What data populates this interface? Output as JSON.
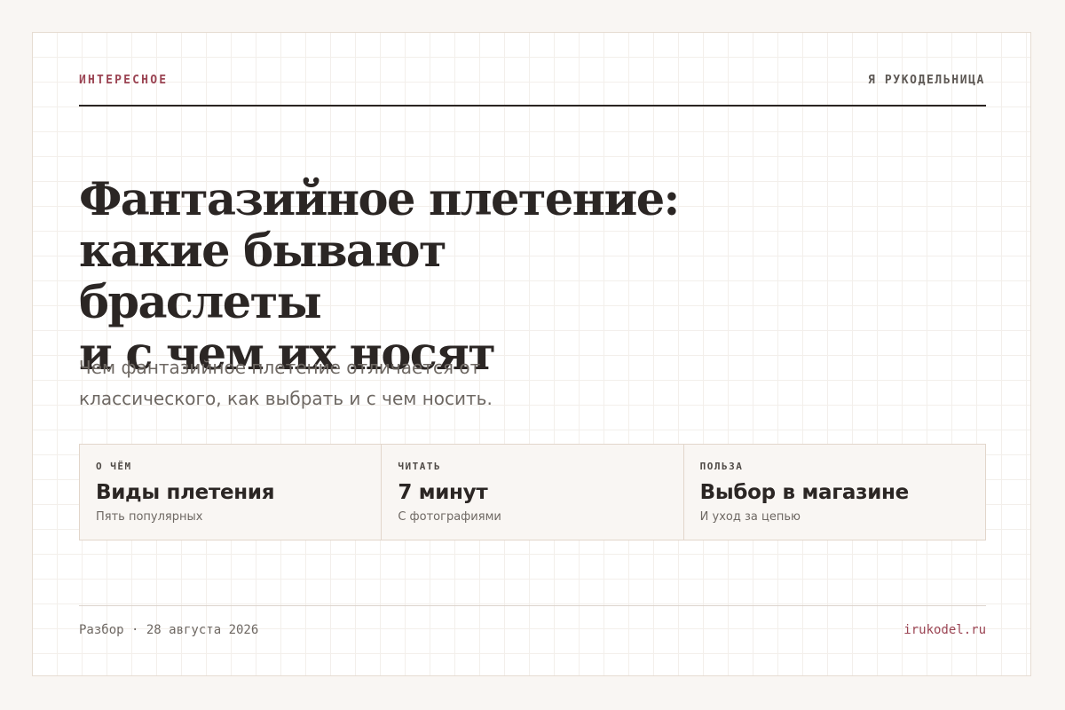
{
  "header": {
    "rubric": "ИНТЕРЕСНОЕ",
    "brand": "Я РУКОДЕЛЬНИЦА"
  },
  "article": {
    "title_lines": [
      "Фантазийное плетение:",
      "какие бывают браслеты",
      "и с чем их носят"
    ],
    "lede_lines": [
      "Чем фантазийное плетение отличается от",
      "классического, как выбрать и с чем носить."
    ]
  },
  "facts": [
    {
      "label": "О ЧЁМ",
      "value": "Виды плетения",
      "note": "Пять популярных"
    },
    {
      "label": "ЧИТАТЬ",
      "value": "7 минут",
      "note": "С фотографиями"
    },
    {
      "label": "ПОЛЬЗА",
      "value": "Выбор в магазине",
      "note": "И уход за цепью"
    }
  ],
  "footer": {
    "meta": "Разбор · 28 августа 2026",
    "site": "irukodel.ru"
  },
  "colors": {
    "accent": "#9b4453",
    "text": "#2b2624",
    "muted": "#6e6863",
    "background": "#f9f6f3"
  }
}
